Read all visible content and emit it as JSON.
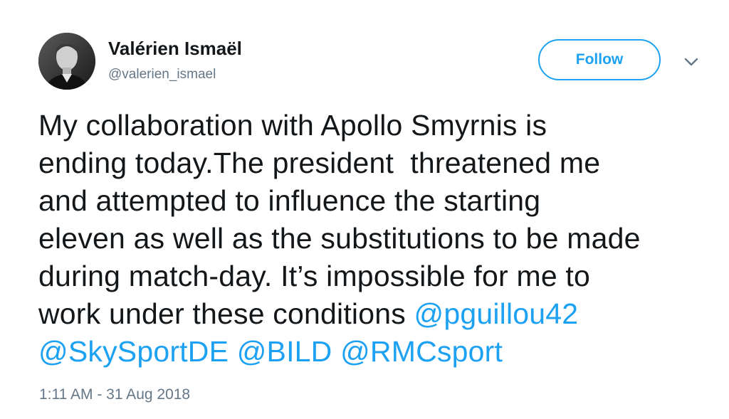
{
  "author": {
    "name": "Valérien Ismaël",
    "handle": "@valerien_ismael"
  },
  "follow_button": {
    "label": "Follow"
  },
  "tweet": {
    "lines": [
      "My collaboration with Apollo Smyrnis is",
      "ending today.The president  threatened me",
      "and attempted to influence the starting",
      "eleven as well as the substitutions to be made",
      "during match-day. It’s impossible for me to",
      "work under these conditions "
    ],
    "mentions": [
      "@pguillou42",
      "@SkySportDE",
      "@BILD",
      "@RMCsport"
    ],
    "timestamp": "1:11 AM - 31 Aug 2018"
  },
  "icons": {
    "avatar": "profile-photo",
    "menu": "chevron-down-icon"
  },
  "colors": {
    "accent": "#1da1f2",
    "text": "#14171a",
    "muted": "#657786"
  }
}
